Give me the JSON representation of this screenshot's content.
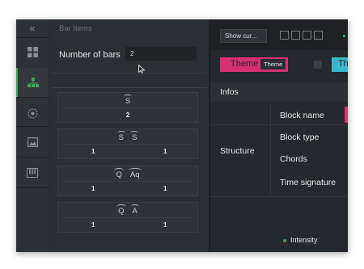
{
  "rail": {
    "collapse": "«",
    "icons": [
      "grid-icon",
      "hierarchy-icon",
      "record-icon",
      "image-icon",
      "piano-icon"
    ]
  },
  "panel": {
    "title": "Bar Items",
    "number_of_bars_label": "Number of bars",
    "number_of_bars_value": "2",
    "cards": [
      {
        "symbols": [
          "S"
        ],
        "counts": [
          "2"
        ]
      },
      {
        "symbols": [
          "S",
          "S"
        ],
        "counts": [
          "1",
          "1"
        ]
      },
      {
        "symbols": [
          "Q",
          "Aq"
        ],
        "counts": [
          "1",
          "1"
        ]
      },
      {
        "symbols": [
          "Q",
          "A"
        ],
        "counts": [
          "1",
          "1"
        ]
      }
    ]
  },
  "toolbar": {
    "show_cursor": "Show cur..."
  },
  "themes": [
    {
      "label": "Theme",
      "badge": "Theme",
      "color": "#d5326f"
    },
    {
      "label": "Theme",
      "color": "#3bb6c9"
    }
  ],
  "info": {
    "infos_label": "Infos",
    "structure_label": "Structure",
    "rows": [
      "Block name",
      "Block type",
      "Chords",
      "Time signature"
    ]
  },
  "legend": {
    "intensity": "Intensity"
  },
  "colors": {
    "accent_green": "#3aa55a",
    "pink": "#d5326f",
    "cyan": "#3bb6c9"
  }
}
